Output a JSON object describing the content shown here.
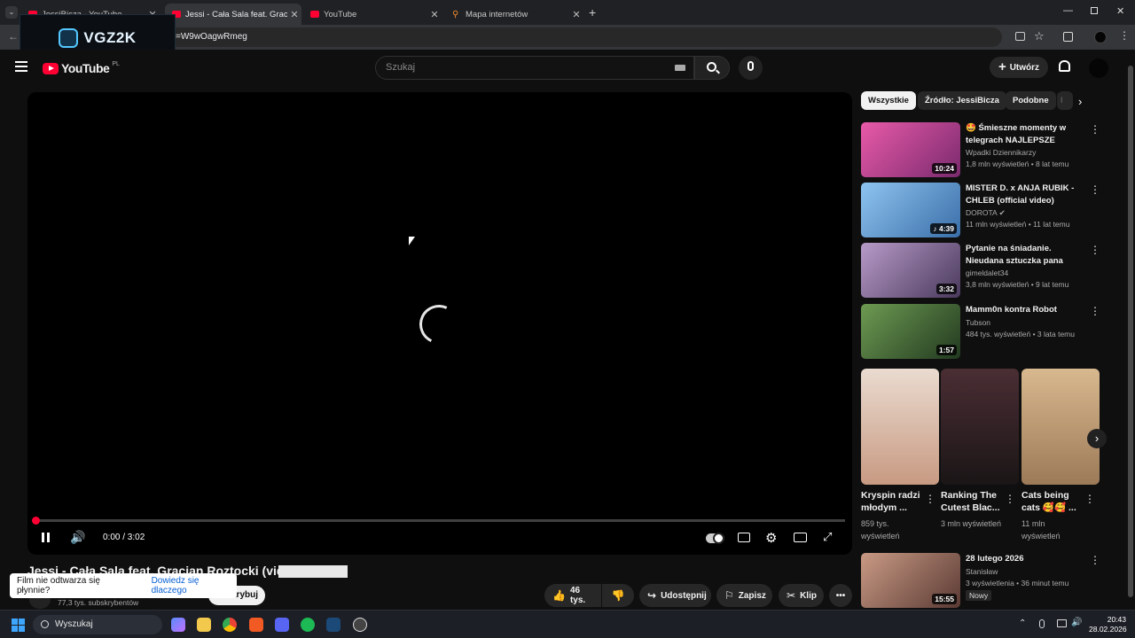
{
  "browser": {
    "tabs": [
      {
        "title": "JessiBicza - YouTube",
        "active": false,
        "favicon": "youtube-icon"
      },
      {
        "title": "Jessi - Cała Sala feat. Gracjan Roztocki",
        "active": true,
        "favicon": "youtube-icon"
      },
      {
        "title": "YouTube",
        "active": false,
        "favicon": "youtube-icon"
      },
      {
        "title": "Mapa internetów",
        "active": false,
        "favicon": "map-pin-icon"
      }
    ],
    "address": "=W9wOagwRmeg",
    "overlay_logo": "VGZ2K"
  },
  "youtube": {
    "logo_text": "YouTube",
    "country": "PL",
    "search_placeholder": "Szukaj",
    "create_label": "Utwórz"
  },
  "player": {
    "time": "0:00 / 3:02",
    "progress": 0,
    "state": "loading"
  },
  "video": {
    "title": "Jessi - Cała Sala feat. Gracjan Roztocki (video)",
    "subscribers": "77,3 tys. subskrybentów",
    "subscribe_label": "krybuj",
    "likes": "46 tys.",
    "share_label": "Udostępnij",
    "save_label": "Zapisz",
    "clip_label": "Klip"
  },
  "toast": {
    "message": "Film nie odtwarza się płynnie?",
    "link": "Dowiedz się dlaczego"
  },
  "chips": [
    "Wszystkie",
    "Źródło: JessiBicza",
    "Podobne",
    "I"
  ],
  "recommendations": [
    {
      "title": "🤩 Śmieszne momenty w telegrach NAJLEPSZE WPADK...",
      "channel": "Wpadki Dziennikarzy",
      "meta": "1,8 mln wyświetleń • 8 lat temu",
      "duration": "10:24",
      "thumb_color": "#c2488e"
    },
    {
      "title": "MISTER D. x ANJA RUBIK - CHLEB (official video)",
      "channel": "DOROTA",
      "meta": "11 mln wyświetleń • 11 lat temu",
      "duration": "4:39",
      "thumb_color": "#6aa6d6",
      "verified": true
    },
    {
      "title": "Pytanie na śniadanie. Nieudana sztuczka pana Ząbka. Przebita...",
      "channel": "gimeldalet34",
      "meta": "3,8 mln wyświetleń • 9 lat temu",
      "duration": "3:32",
      "thumb_color": "#8a6d9c"
    },
    {
      "title": "Mamm0n kontra Robot",
      "channel": "Tubson",
      "meta": "484 tys. wyświetleń • 3 lata temu",
      "duration": "1:57",
      "thumb_color": "#3f6a3a"
    }
  ],
  "shorts": [
    {
      "title": "Kryspin radzi młodym ...",
      "views": "859 tys. wyświetleń",
      "thumb_color": "#d9b8a0"
    },
    {
      "title": "Ranking The Cutest Blac...",
      "views": "3 mln wyświetleń",
      "thumb_color": "#3a2a2c"
    },
    {
      "title": "Cats being cats 🥰🥰 ...",
      "views": "11 mln wyświetleń",
      "thumb_color": "#c9a27a"
    }
  ],
  "more_rec": {
    "title": "28 lutego 2026",
    "channel": "Stanisław",
    "meta": "3 wyświetlenia • 36 minut temu",
    "badge": "Nowy",
    "duration": "15:55",
    "thumb_color": "#b88a74"
  },
  "taskbar": {
    "search_label": "Wyszukaj",
    "time": "20:43",
    "date": "28.02.2026"
  }
}
